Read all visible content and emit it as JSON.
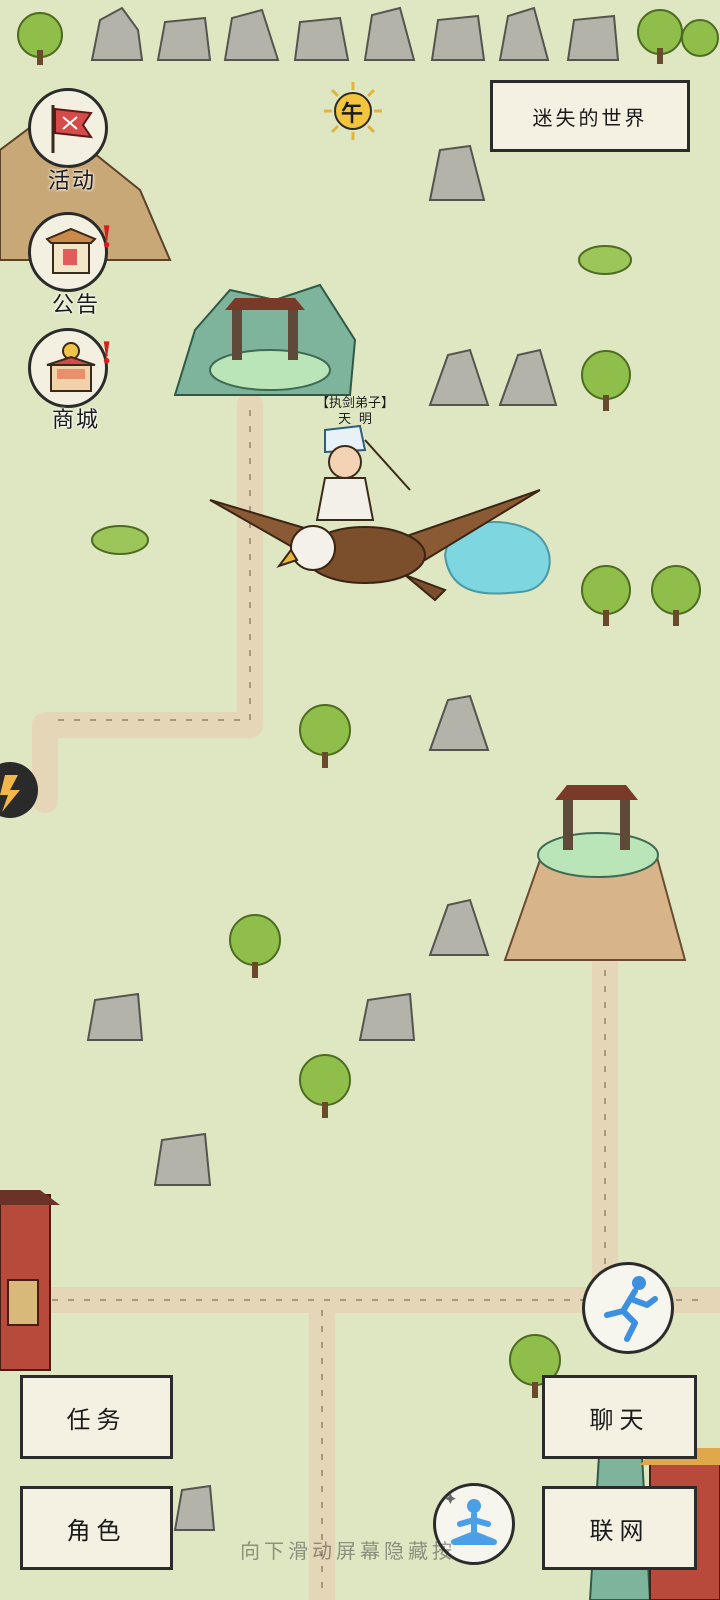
{
  "world_title": "迷失的世界",
  "time_of_day": "午",
  "side_menu": [
    {
      "label": "活动",
      "icon": "flag-icon",
      "badge": ""
    },
    {
      "label": "公告",
      "icon": "notice-board-icon",
      "badge": "!"
    },
    {
      "label": "商城",
      "icon": "shop-icon",
      "badge": "!"
    }
  ],
  "player": {
    "title": "【执剑弟子】",
    "name": "天 明"
  },
  "bottom_left": {
    "quest_label": "任务",
    "character_label": "角色"
  },
  "bottom_right": {
    "chat_label": "聊天",
    "network_label": "联网"
  },
  "actions": {
    "run_icon": "running-man-icon",
    "meditate_icon": "meditation-icon"
  },
  "hint": "向下滑动屏幕隐藏按"
}
